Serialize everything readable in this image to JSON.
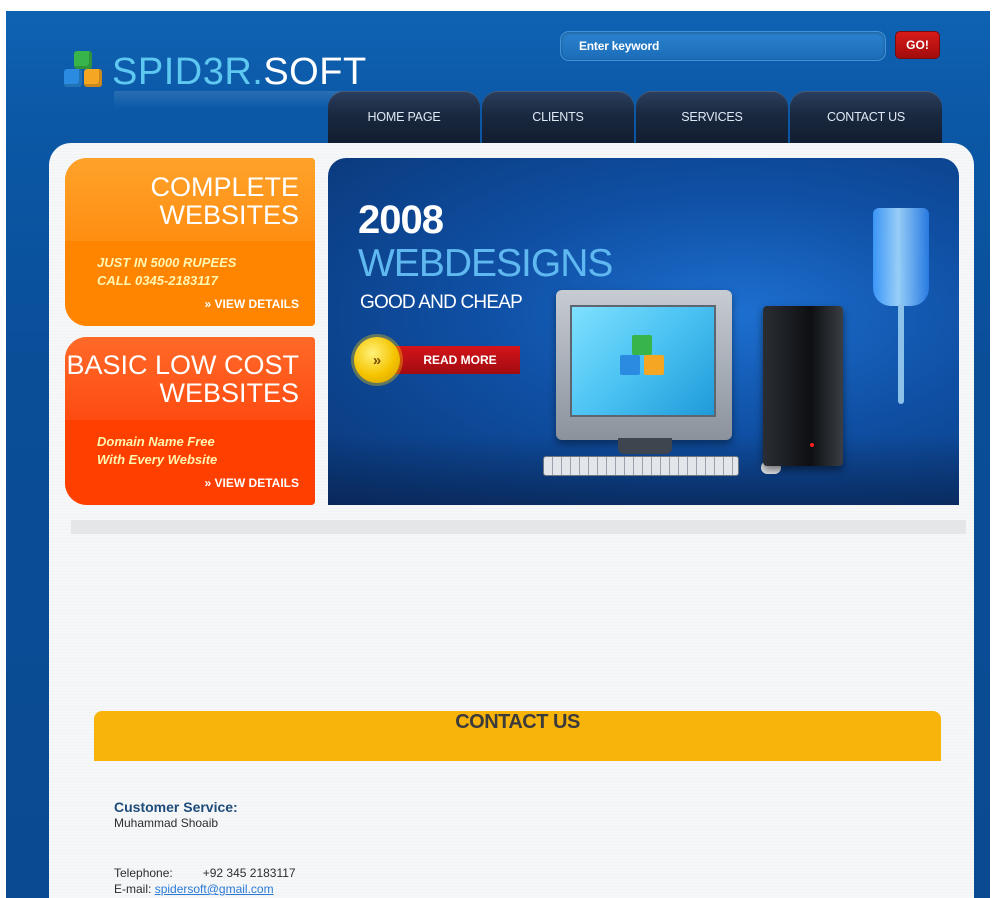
{
  "header": {
    "logo_text_part1": "SPID3R.",
    "logo_text_part2": "SOFT",
    "search_placeholder": "Enter keyword",
    "go_label": "GO!"
  },
  "nav": {
    "items": [
      "HOME PAGE",
      "CLIENTS",
      "SERVICES",
      "CONTACT US"
    ]
  },
  "promos": [
    {
      "title_line1": "COMPLETE",
      "title_line2": "WEBSITES",
      "detail_line1": "JUST IN 5000 RUPEES",
      "detail_line2": "CALL 0345-2183117",
      "link_label": "» VIEW DETAILS"
    },
    {
      "title_line1": "BASIC LOW COST",
      "title_line2": "WEBSITES",
      "detail_line1": "Domain Name Free",
      "detail_line2": "With Every Website",
      "link_label": "» VIEW DETAILS"
    }
  ],
  "banner": {
    "year": "2008",
    "headline": "WEBDESIGNS",
    "subline": "GOOD AND CHEAP",
    "read_more_label": "READ MORE",
    "read_more_glyph": "»"
  },
  "contact": {
    "title": "CONTACT US",
    "customer_service_label": "Customer Service:",
    "customer_service_name": "Muhammad Shoaib",
    "telephone_label": "Telephone:",
    "telephone_value": "+92 345 2183117",
    "email_label": "E-mail:",
    "email_value": "spidersoft@gmail.com"
  },
  "colors": {
    "page_blue": "#0a4e98",
    "logo_accent": "#5fc8f1",
    "promo_orange": "#ff8a0a",
    "promo_red": "#ff3a08",
    "contact_bar": "#f9b40c",
    "go_red": "#c21313"
  },
  "icons": {
    "logo": "cubes-logo-icon",
    "read_more": "double-chevron-icon"
  }
}
